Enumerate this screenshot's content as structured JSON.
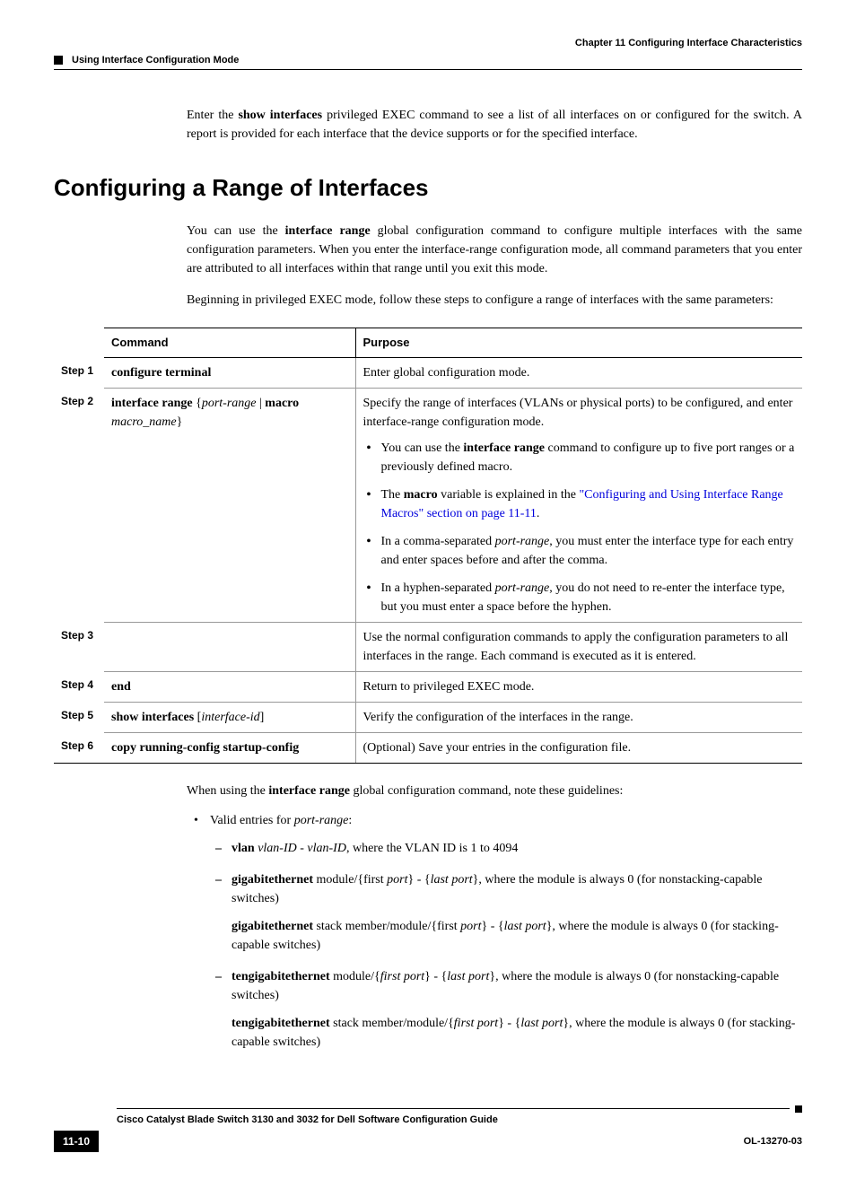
{
  "header": {
    "chapter": "Chapter 11      Configuring Interface Characteristics",
    "section": "Using Interface Configuration Mode"
  },
  "intro": {
    "p1_before": "Enter the ",
    "p1_bold": "show interfaces",
    "p1_after": " privileged EXEC command to see a list of all interfaces on or configured for the switch. A report is provided for each interface that the device supports or for the specified interface."
  },
  "heading": "Configuring a Range of Interfaces",
  "sec": {
    "p1_a": "You can use the ",
    "p1_b": "interface range",
    "p1_c": " global configuration command to configure multiple interfaces with the same configuration parameters. When you enter the interface-range configuration mode, all command parameters that you enter are attributed to all interfaces within that range until you exit this mode.",
    "p2": "Beginning in privileged EXEC mode, follow these steps to configure a range of interfaces with the same parameters:"
  },
  "table": {
    "h1": "Command",
    "h2": "Purpose",
    "steps": {
      "s1": "Step 1",
      "s2": "Step 2",
      "s3": "Step 3",
      "s4": "Step 4",
      "s5": "Step 5",
      "s6": "Step 6"
    },
    "r1": {
      "cmd": "configure terminal",
      "purpose": "Enter global configuration mode."
    },
    "r2": {
      "cmd_b1": "interface range",
      "cmd_t1": " {",
      "cmd_i1": "port-range",
      "cmd_t2": " | ",
      "cmd_b2": "macro",
      "cmd_i2": "macro_name",
      "cmd_t3": "}",
      "p1": "Specify the range of interfaces (VLANs or physical ports) to be configured, and enter interface-range configuration mode.",
      "b1_a": "You can use the ",
      "b1_b": "interface range",
      "b1_c": " command to configure up to five port ranges or a previously defined macro.",
      "b2_a": "The ",
      "b2_b": "macro",
      "b2_c": " variable is explained in the ",
      "b2_link": "\"Configuring and Using Interface Range Macros\" section on page 11-11",
      "b2_d": ".",
      "b3_a": "In a comma-separated ",
      "b3_i": "port-range",
      "b3_b": ", you must enter the interface type for each entry and enter spaces before and after the comma.",
      "b4_a": "In a hyphen-separated ",
      "b4_i": "port-range",
      "b4_b": ", you do not need to re-enter the interface type, but you must enter a space before the hyphen."
    },
    "r3": {
      "purpose": "Use the normal configuration commands to apply the configuration parameters to all interfaces in the range. Each command is executed as it is entered."
    },
    "r4": {
      "cmd": "end",
      "purpose": "Return to privileged EXEC mode."
    },
    "r5": {
      "cmd_b": "show interfaces",
      "cmd_t1": " [",
      "cmd_i": "interface-id",
      "cmd_t2": "]",
      "purpose": "Verify the configuration of the interfaces in the range."
    },
    "r6": {
      "cmd": "copy running-config startup-config",
      "purpose": "(Optional) Save your entries in the configuration file."
    }
  },
  "guidelines": {
    "intro_a": "When using the ",
    "intro_b": "interface range",
    "intro_c": " global configuration command, note these guidelines:",
    "li1_a": "Valid entries for ",
    "li1_i": "port-range",
    "li1_b": ":",
    "s1_b": "vlan",
    "s1_i1": "vlan-ID",
    "s1_t": " - ",
    "s1_i2": "vlan-ID",
    "s1_a": ", where the VLAN ID is 1 to 4094",
    "s2_b": "gigabitethernet",
    "s2_t1": " module/{first ",
    "s2_i1": "port",
    "s2_t2": "} - {",
    "s2_i2": "last port",
    "s2_t3": "}, where the module is always 0 (for nonstacking-capable switches)",
    "s2p_b": "gigabitethernet",
    "s2p_t1": " stack member/module/{first ",
    "s2p_i1": "port",
    "s2p_t2": "} - {",
    "s2p_i2": "last port",
    "s2p_t3": "}, where the module is always 0 (for stacking-capable switches)",
    "s3_b": "tengigabitethernet",
    "s3_t1": " module/{",
    "s3_i1": "first port",
    "s3_t2": "} - {",
    "s3_i2": "last port",
    "s3_t3": "}, where the module is always 0 (for nonstacking-capable switches)",
    "s3p_b": "tengigabitethernet",
    "s3p_t1": " stack member/module/{",
    "s3p_i1": "first port",
    "s3p_t2": "} - {",
    "s3p_i2": "last port",
    "s3p_t3": "}, where the module is always 0 (for stacking-capable switches)"
  },
  "footer": {
    "title": "Cisco Catalyst Blade Switch 3130 and 3032 for Dell Software Configuration Guide",
    "page": "11-10",
    "docid": "OL-13270-03"
  }
}
